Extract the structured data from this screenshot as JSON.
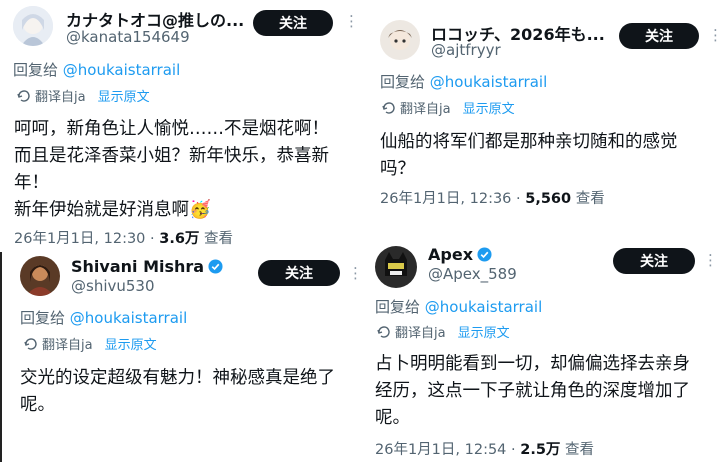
{
  "tweets": [
    {
      "name": "カナタトオコ@推しの...",
      "handle": "@kanata154649",
      "follow_label": "关注",
      "reply_prefix": "回复给 ",
      "reply_to": "@houkaistarrail",
      "translated_from": "翻译自ja",
      "show_original": "显示原文",
      "body_lines": [
        "呵呵，新角色让人愉悦……不是烟花啊！",
        "而且是花泽香菜小姐？新年快乐，恭喜新",
        "年！",
        "新年伊始就是好消息啊🥳"
      ],
      "date": "26年1月1日, 12:30 · ",
      "views": "3.6万",
      "views_suffix": " 查看",
      "verified": false
    },
    {
      "name": "ロコッチ、2026年も...",
      "handle": "@ajtfryyr",
      "follow_label": "关注",
      "reply_prefix": "回复给 ",
      "reply_to": "@houkaistarrail",
      "translated_from": "翻译自ja",
      "show_original": "显示原文",
      "body_lines": [
        "仙船的将军们都是那种亲切随和的感觉",
        "吗？"
      ],
      "date": "26年1月1日, 12:36 · ",
      "views": "5,560",
      "views_suffix": " 查看",
      "verified": false
    },
    {
      "name": "Shivani Mishra",
      "handle": "@shivu530",
      "follow_label": "关注",
      "reply_prefix": "回复给 ",
      "reply_to": "@houkaistarrail",
      "translated_from": "翻译自ja",
      "show_original": "显示原文",
      "body_lines": [
        "交光的设定超级有魅力！神秘感真是绝了",
        "呢。"
      ],
      "verified": true
    },
    {
      "name": "Apex",
      "handle": "@Apex_589",
      "follow_label": "关注",
      "reply_prefix": "回复给 ",
      "reply_to": "@houkaistarrail",
      "translated_from": "翻译自ja",
      "show_original": "显示原文",
      "body_lines": [
        "占卜明明能看到一切，却偏偏选择去亲身",
        "经历，这点一下子就让角色的深度增加了",
        "呢。"
      ],
      "date": "26年1月1日, 12:54 · ",
      "views": "2.5万",
      "views_suffix": " 查看",
      "verified": true
    }
  ],
  "colors": {
    "link": "#1d9bf0",
    "muted": "#536471",
    "text": "#0f1419",
    "button": "#0f1419"
  },
  "icons": {
    "translate": "translate-icon",
    "more": "more-options-icon",
    "verified": "verified-badge-icon"
  }
}
